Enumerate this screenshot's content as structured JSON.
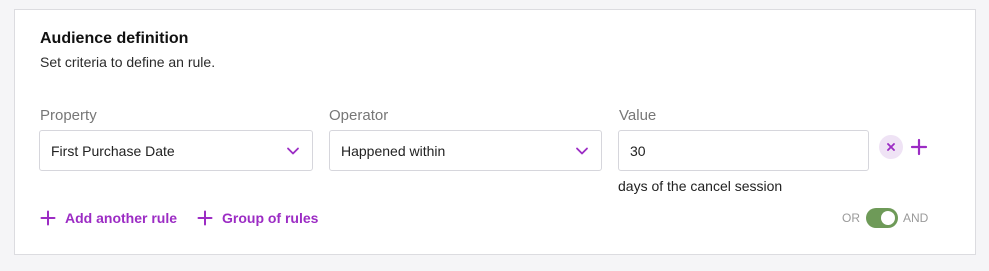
{
  "section": {
    "title": "Audience definition",
    "subtitle": "Set criteria to define an rule."
  },
  "rule": {
    "property": {
      "label": "Property",
      "selected": "First Purchase Date"
    },
    "operator": {
      "label": "Operator",
      "selected": "Happened within"
    },
    "value": {
      "label": "Value",
      "current": "30",
      "suffix": "days of the cancel session"
    }
  },
  "actions": {
    "add_rule": "Add another rule",
    "group_rules": "Group of rules"
  },
  "logic_toggle": {
    "left_label": "OR",
    "right_label": "AND",
    "selected": "AND"
  },
  "colors": {
    "accent": "#9c2cc4",
    "toggle_on": "#6e9a58",
    "remove_bg": "#efe3f5"
  },
  "icons": {
    "dropdown": "chevron-down-icon",
    "remove": "close-icon",
    "add": "plus-icon"
  }
}
